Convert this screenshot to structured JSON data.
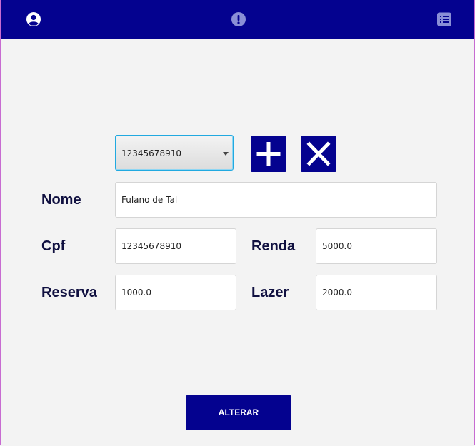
{
  "topbar": {
    "icons": [
      "user-circle-icon",
      "alert-circle-icon",
      "list-icon"
    ]
  },
  "account_select": {
    "selected": "12345678910"
  },
  "buttons": {
    "add_icon": "plus-icon",
    "remove_icon": "close-icon",
    "submit_label": "ALTERAR"
  },
  "form": {
    "nome": {
      "label": "Nome",
      "value": "Fulano de Tal"
    },
    "cpf": {
      "label": "Cpf",
      "value": "12345678910"
    },
    "renda": {
      "label": "Renda",
      "value": "5000.0"
    },
    "reserva": {
      "label": "Reserva",
      "value": "1000.0"
    },
    "lazer": {
      "label": "Lazer",
      "value": "2000.0"
    }
  },
  "colors": {
    "primary": "#04028f",
    "background": "#f3f3f3",
    "label": "#101040"
  }
}
